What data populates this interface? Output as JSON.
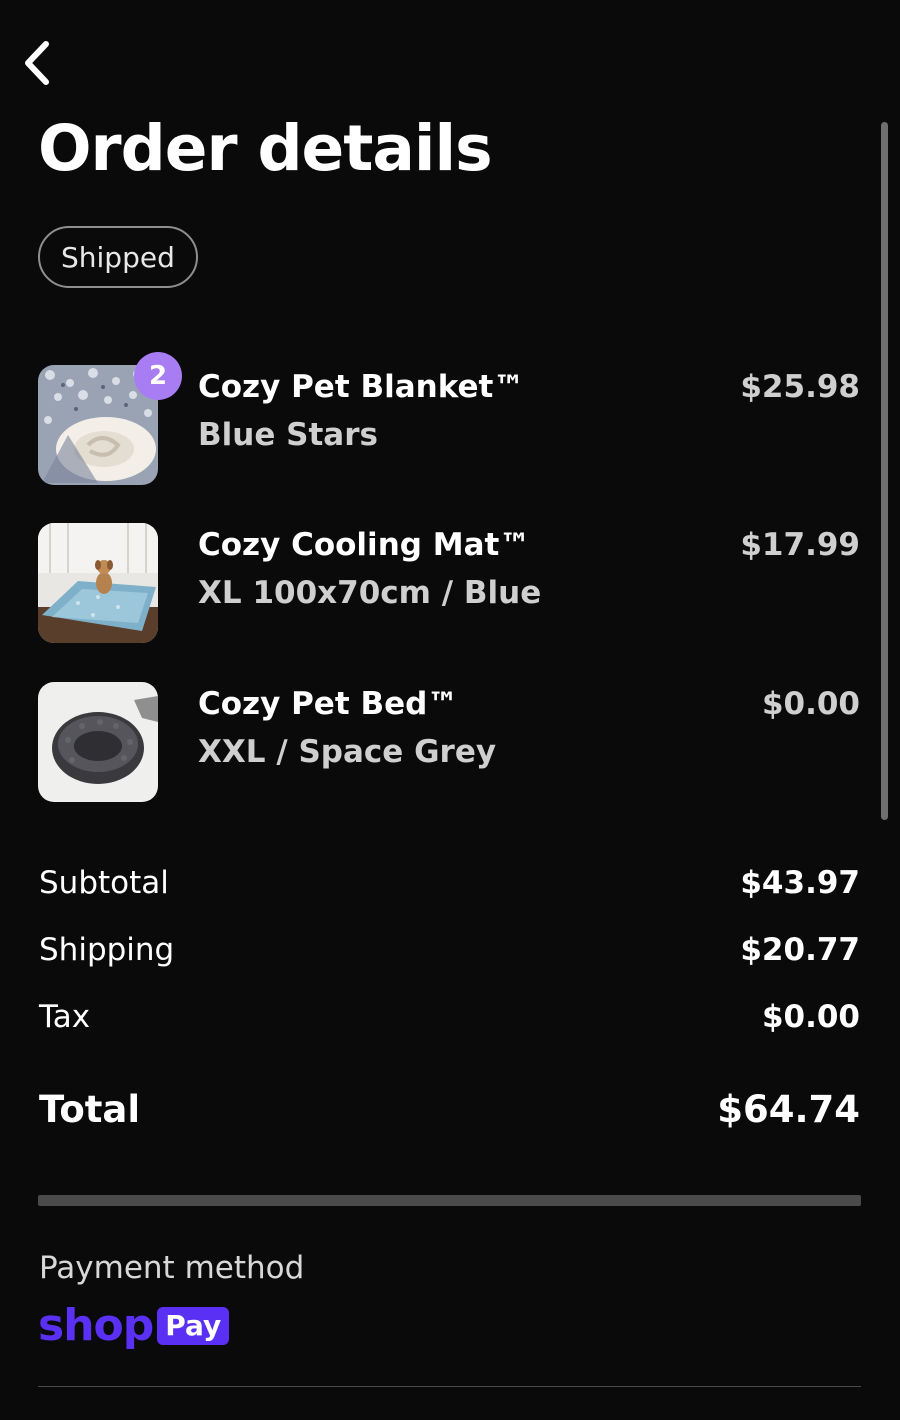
{
  "header": {
    "title": "Order details",
    "back_icon": "chevron-left-icon"
  },
  "status": {
    "label": "Shipped"
  },
  "items": [
    {
      "name": "Cozy Pet Blanket™",
      "variant": "Blue Stars",
      "price": "$25.98",
      "quantity": "2"
    },
    {
      "name": "Cozy Cooling Mat™",
      "variant": "XL 100x70cm / Blue",
      "price": "$17.99"
    },
    {
      "name": "Cozy Pet Bed™",
      "variant": "XXL / Space Grey",
      "price": "$0.00"
    }
  ],
  "summary": {
    "subtotal_label": "Subtotal",
    "subtotal_value": "$43.97",
    "shipping_label": "Shipping",
    "shipping_value": "$20.77",
    "tax_label": "Tax",
    "tax_value": "$0.00",
    "total_label": "Total",
    "total_value": "$64.74"
  },
  "payment": {
    "label": "Payment method",
    "brand_word": "shop",
    "brand_pay": "Pay",
    "brand_color": "#5a31f4"
  },
  "colors": {
    "background": "#0a0a0a",
    "badge": "#a87cf2"
  }
}
